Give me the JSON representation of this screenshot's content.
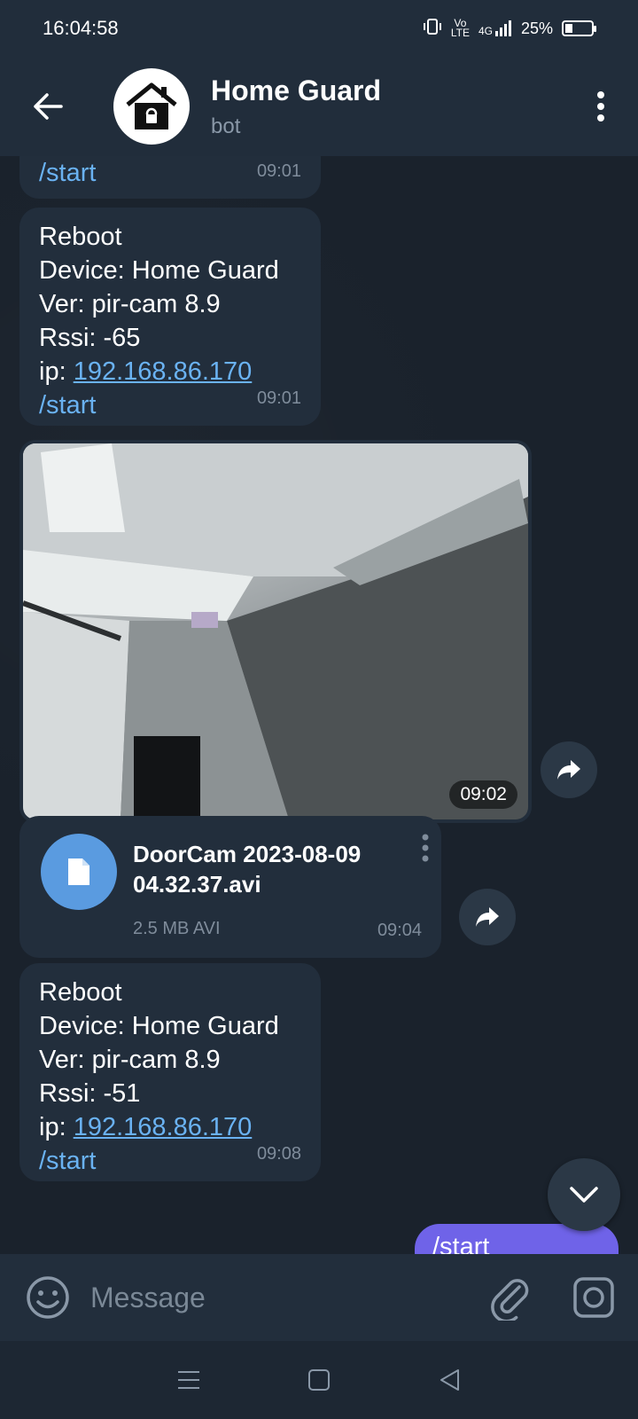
{
  "status_bar": {
    "time": "16:04:58",
    "network": "4G",
    "battery": "25%"
  },
  "header": {
    "title": "Home Guard",
    "subtitle": "bot"
  },
  "messages": [
    {
      "id": "m0",
      "lines": [
        "/start"
      ],
      "time": "09:01"
    },
    {
      "id": "m1",
      "reboot": "Reboot",
      "device": "Device: Home Guard",
      "ver": "Ver: pir-cam 8.9",
      "rssi": "Rssi: -65",
      "ip_label": "ip: ",
      "ip": "192.168.86.170",
      "cmd": "/start",
      "time": "09:01"
    },
    {
      "id": "photo",
      "time": "09:02"
    },
    {
      "id": "file",
      "name": "DoorCam 2023-08-09 04.32.37.avi",
      "size": "2.5 MB AVI",
      "time": "09:04"
    },
    {
      "id": "m2",
      "reboot": "Reboot",
      "device": "Device: Home Guard",
      "ver": "Ver: pir-cam 8.9",
      "rssi": "Rssi: -51",
      "ip_label": "ip: ",
      "ip": "192.168.86.170",
      "cmd": "/start",
      "time": "09:08"
    }
  ],
  "outgoing": {
    "text": "/start"
  },
  "input": {
    "placeholder": "Message"
  },
  "colors": {
    "header_bg": "#212d3b",
    "chat_bg": "#1a222c",
    "bubble_bg": "#222e3c",
    "link": "#6ab2f2",
    "file_icon_bg": "#5a9be0",
    "outgoing_bg": "#6f63e8"
  }
}
